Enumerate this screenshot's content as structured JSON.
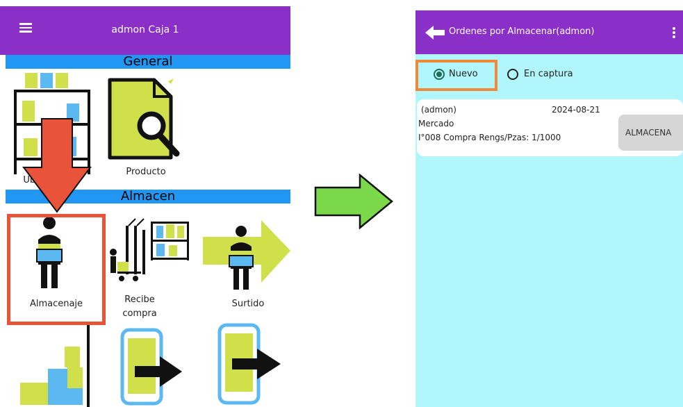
{
  "left_screen": {
    "appbar": {
      "title": "admon Caja 1",
      "menu_icon": "hamburger-menu-icon"
    },
    "sections": {
      "general": "General",
      "almacen": "Almacen"
    },
    "tiles": {
      "ubicaciones": "Ubicaciones",
      "producto": "Producto",
      "almacenaje": "Almacenaje",
      "recibe_compra_line1": "Recibe",
      "recibe_compra_line2": "compra",
      "surtido": "Surtido"
    }
  },
  "right_screen": {
    "appbar": {
      "title": "Ordenes por Almacenar(admon)",
      "back_icon": "back-arrow-icon",
      "overflow_icon": "more-vert-icon"
    },
    "filters": {
      "nuevo": "Nuevo",
      "en_captura": "En captura",
      "selected": "Nuevo"
    },
    "order": {
      "user": "(admon)",
      "date": "2024-08-21",
      "store": "Mercado",
      "detail": "I°008 Compra Rengs/Pzas: 1/1000",
      "action_label": "ALMACENA"
    }
  },
  "colors": {
    "appbar": "#8b2fc9",
    "section_header": "#2196f3",
    "highlight_red": "#e8533a",
    "highlight_orange": "#f08a3a",
    "right_background": "#b0f6fb",
    "transition_arrow": "#7bd84a"
  }
}
